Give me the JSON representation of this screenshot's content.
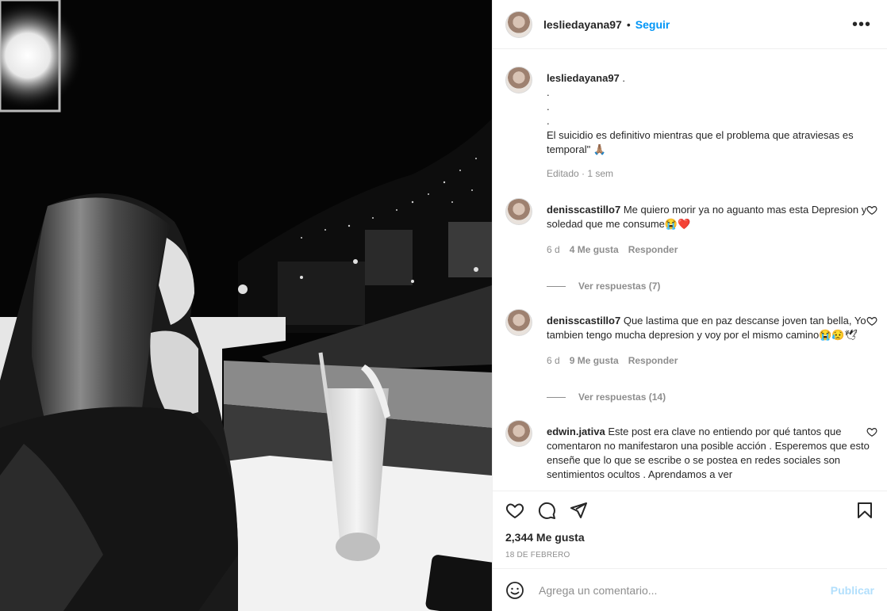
{
  "post": {
    "username": "lesliedayana97",
    "separator": "•",
    "follow_label": "Seguir",
    "more_label": "•••"
  },
  "caption": {
    "username": "lesliedayana97",
    "line1": " .",
    "line2": ".",
    "line3": ".",
    "line4": ".",
    "text": "El suicidio es definitivo mientras que el problema que atraviesas es temporal\" 🙏🏽",
    "meta": "Editado · 1 sem"
  },
  "comments": [
    {
      "username": "denisscastillo7",
      "text": "Me quiero morir ya no aguanto mas esta Depresion y soledad que me consume😭❤️",
      "time": "6 d",
      "likes": "4 Me gusta",
      "reply": "Responder",
      "view_replies": "Ver respuestas (7)"
    },
    {
      "username": "denisscastillo7",
      "text": "Que lastima que en paz descanse joven tan bella, Yo tambien tengo mucha depresion y voy por el mismo camino😭😥🕊",
      "time": "6 d",
      "likes": "9 Me gusta",
      "reply": "Responder",
      "view_replies": "Ver respuestas (14)"
    },
    {
      "username": "edwin.jativa",
      "text": "Este post era clave no entiendo por qué tantos que comentaron no manifestaron una posible acción . Esperemos que esto enseñe que lo que se escribe o se postea en redes sociales son sentimientos ocultos . Aprendamos a ver"
    }
  ],
  "likes_count": "2,344 Me gusta",
  "date": "18 DE FEBRERO",
  "add_comment": {
    "placeholder": "Agrega un comentario...",
    "publish_label": "Publicar"
  },
  "icons": [
    "heart-icon",
    "comment-icon",
    "share-icon",
    "bookmark-icon",
    "emoji-icon",
    "more-icon"
  ],
  "colors": {
    "accent": "#0095f6",
    "publish_disabled": "#b2dffc",
    "muted": "#8e8e8e"
  }
}
